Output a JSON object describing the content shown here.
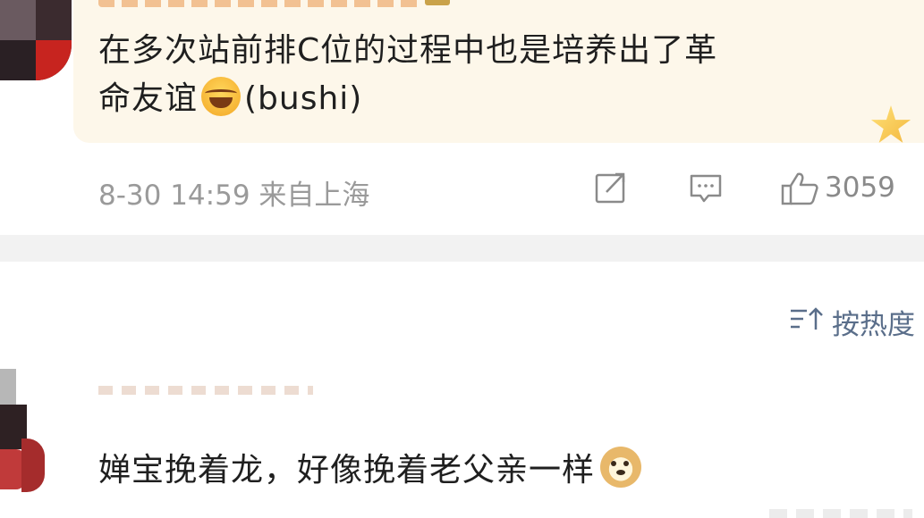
{
  "comment1": {
    "text_line1": "在多次站前排C位的过程中也是培养出了革",
    "text_line2_pre": "命友谊",
    "emoji": "laughing-tears-emoji",
    "text_line2_post": "(bushi)",
    "meta": "8-30 14:59 来自上海",
    "like_count": "3059"
  },
  "sort": {
    "label": "按热度"
  },
  "comment2": {
    "text": "婵宝挽着龙，好像挽着老父亲一样",
    "emoji": "doge-emoji"
  },
  "colors": {
    "highlight_bg": "#fdf7ea",
    "meta_text": "#9a9a9a",
    "sort_text": "#5a6e8a",
    "divider": "#f2f2f2"
  }
}
